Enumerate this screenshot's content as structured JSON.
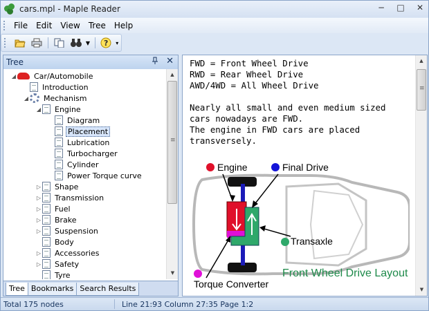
{
  "window": {
    "title": "cars.mpl - Maple Reader",
    "buttons": [
      "−",
      "□",
      "✕"
    ]
  },
  "menu": [
    "File",
    "Edit",
    "View",
    "Tree",
    "Help"
  ],
  "toolbar": {
    "buttons": [
      {
        "name": "open-icon",
        "glyph": "📂"
      },
      {
        "name": "print-icon",
        "glyph": "🖨"
      },
      {
        "name": "copy-icon",
        "glyph": "⎘"
      },
      {
        "name": "find-icon",
        "glyph": "🔭"
      },
      {
        "name": "help-icon",
        "glyph": "?"
      }
    ]
  },
  "panel": {
    "title": "Tree",
    "pin": "ᵖ",
    "close": "✕"
  },
  "tree": [
    {
      "label": "Car/Automobile",
      "level": 0,
      "icon": "car-icon",
      "toggle": "◢"
    },
    {
      "label": "Introduction",
      "level": 1,
      "icon": "document-icon",
      "toggle": ""
    },
    {
      "label": "Mechanism",
      "level": 1,
      "icon": "gear-icon",
      "toggle": "◢"
    },
    {
      "label": "Engine",
      "level": 2,
      "icon": "document-icon",
      "toggle": "◢"
    },
    {
      "label": "Diagram",
      "level": 3,
      "icon": "document-icon",
      "toggle": ""
    },
    {
      "label": "Placement",
      "level": 3,
      "icon": "document-icon",
      "toggle": "",
      "selected": true
    },
    {
      "label": "Lubrication",
      "level": 3,
      "icon": "document-icon",
      "toggle": ""
    },
    {
      "label": "Turbocharger",
      "level": 3,
      "icon": "document-icon",
      "toggle": ""
    },
    {
      "label": "Cylinder",
      "level": 3,
      "icon": "document-icon",
      "toggle": ""
    },
    {
      "label": "Power Torque curve",
      "level": 3,
      "icon": "document-icon",
      "toggle": ""
    },
    {
      "label": "Shape",
      "level": 2,
      "icon": "document-icon",
      "toggle": "▷"
    },
    {
      "label": "Transmission",
      "level": 2,
      "icon": "document-icon",
      "toggle": "▷"
    },
    {
      "label": "Fuel",
      "level": 2,
      "icon": "document-icon",
      "toggle": "▷"
    },
    {
      "label": "Brake",
      "level": 2,
      "icon": "document-icon",
      "toggle": "▷"
    },
    {
      "label": "Suspension",
      "level": 2,
      "icon": "document-icon",
      "toggle": "▷"
    },
    {
      "label": "Body",
      "level": 2,
      "icon": "document-icon",
      "toggle": ""
    },
    {
      "label": "Accessories",
      "level": 2,
      "icon": "document-icon",
      "toggle": "▷"
    },
    {
      "label": "Safety",
      "level": 2,
      "icon": "document-icon",
      "toggle": "▷"
    },
    {
      "label": "Tyre",
      "level": 2,
      "icon": "document-icon",
      "toggle": ""
    }
  ],
  "tabs": [
    "Tree",
    "Bookmarks",
    "Search Results"
  ],
  "content": {
    "definitions": [
      "FWD = Front Wheel Drive",
      "RWD = Rear Wheel Drive",
      "AWD/4WD = All Wheel Drive"
    ],
    "paragraph": [
      "Nearly all small and even medium sized",
      "cars nowadays are FWD.",
      "The engine in FWD cars are placed",
      "transversely."
    ]
  },
  "diagram": {
    "labels": {
      "engine": "Engine",
      "final_drive": "Final Drive",
      "transaxle": "Transaxle",
      "torque_converter": "Torque Converter",
      "caption": "Front Wheel Drive Layout"
    },
    "colors": {
      "engine": "#e0102a",
      "final_drive": "#1414d8",
      "transaxle": "#2fa86a",
      "torque_converter": "#e010d8",
      "caption": "#1e8a4a"
    }
  },
  "status": {
    "nodes": "Total 175 nodes",
    "position": "Line 21:93  Column 27:35  Page 1:2"
  }
}
